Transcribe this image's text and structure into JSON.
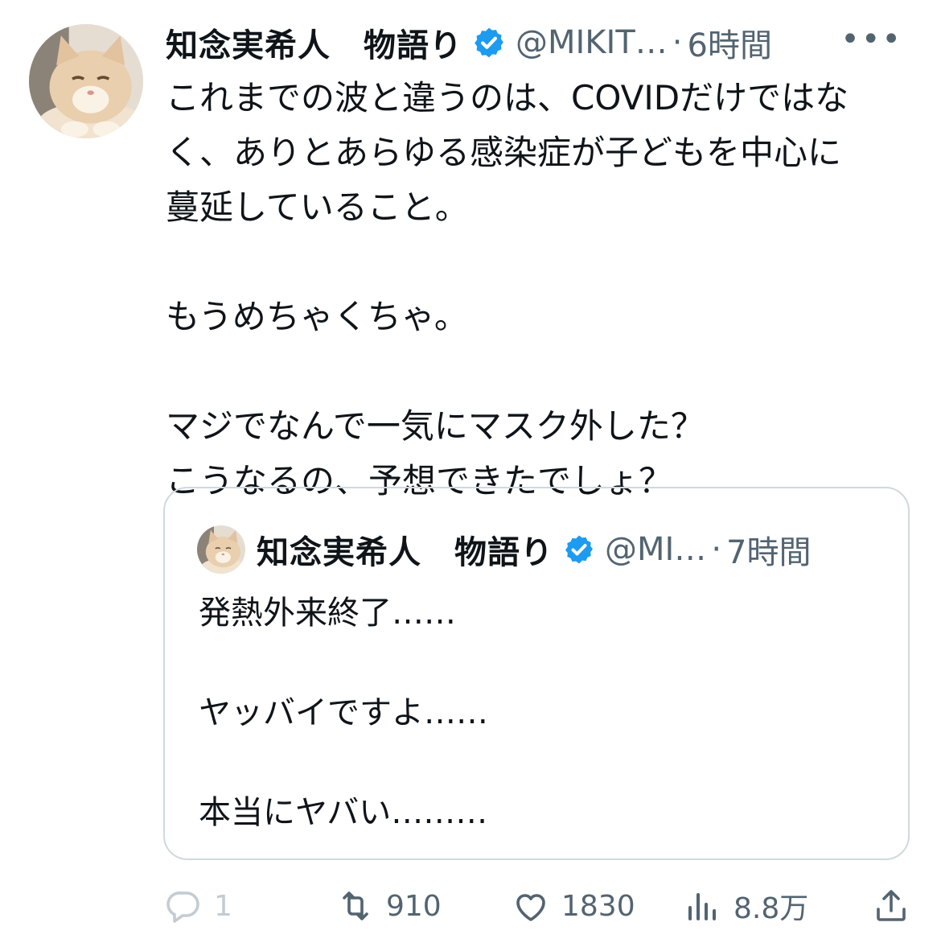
{
  "tweet": {
    "author_name": "知念実希人　物語り",
    "handle": "@MIKIT…",
    "separator": "·",
    "time": "6時間",
    "more_label": "•••",
    "body_lines": [
      "これまでの波と違うのは、COVIDだけではな",
      "く、ありとあらゆる感染症が子どもを中心に",
      "蔓延していること。",
      "もうめちゃくちゃ。",
      "マジでなんで一気にマスク外した？",
      "こうなるの、予想できたでしょ？"
    ]
  },
  "quoted_tweet": {
    "author_name": "知念実希人　物語り",
    "handle": "@MI…",
    "separator": "·",
    "time": "7時間",
    "body_lines": [
      "発熱外来終了……",
      "ヤッバイですよ……",
      "本当にヤバい………"
    ]
  },
  "actions": {
    "reply_count": "1",
    "retweet_count": "910",
    "like_count": "1830",
    "views_count": "8.8万"
  },
  "icons": {
    "verified": "verified-badge-icon",
    "reply": "reply-icon",
    "retweet": "retweet-icon",
    "like": "heart-icon",
    "views": "views-icon",
    "share": "share-icon"
  },
  "colors": {
    "text": "#0f1419",
    "secondary": "#536471",
    "verified": "#1d9bf0",
    "border": "#cfd9de"
  }
}
